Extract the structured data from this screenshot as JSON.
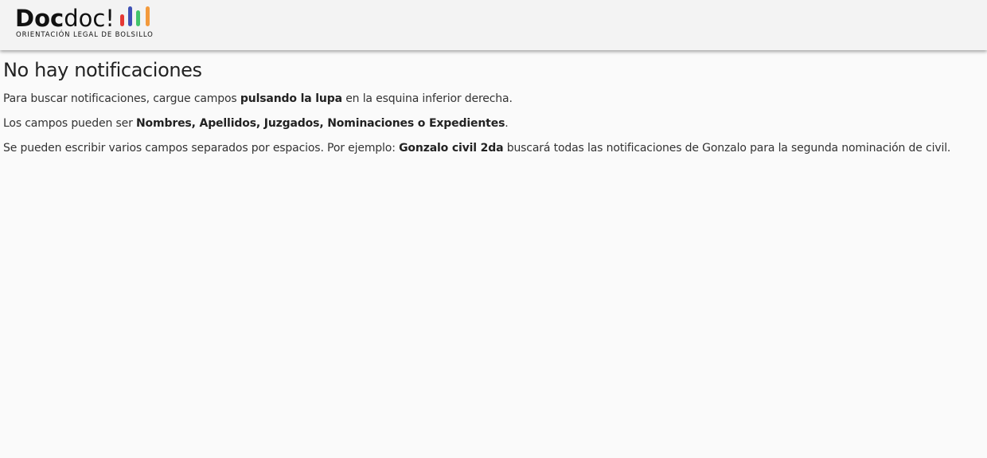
{
  "header": {
    "logo": {
      "word_bold": "Doc",
      "word_light": "doc!",
      "tagline": "ORIENTACIÓN LEGAL DE BOLSILLO",
      "bar_colors": [
        "#e53935",
        "#3f51b5",
        "#43c46b",
        "#f39a3c"
      ]
    }
  },
  "main": {
    "title": "No hay notificaciones",
    "paragraphs": [
      {
        "before": "Para buscar notificaciones, cargue campos ",
        "bold": "pulsando la lupa",
        "after": " en la esquina inferior derecha."
      },
      {
        "before": "Los campos pueden ser ",
        "bold": "Nombres, Apellidos, Juzgados, Nominaciones o Expedientes",
        "after": "."
      },
      {
        "before": "Se pueden escribir varios campos separados por espacios. Por ejemplo: ",
        "bold": "Gonzalo civil 2da",
        "after": " buscará todas las notificaciones de Gonzalo para la segunda nominación de civil."
      }
    ]
  }
}
